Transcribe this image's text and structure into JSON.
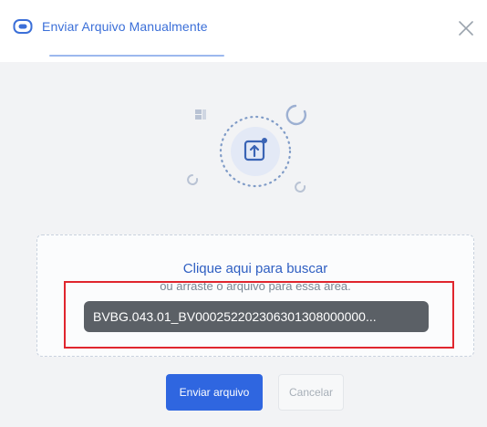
{
  "header": {
    "tab_label": "Enviar Arquivo Manualmente",
    "tab_icon": "file-badge-icon",
    "close_icon": "close-icon"
  },
  "illustration": {
    "center_icon": "upload-icon",
    "decor": [
      "grid-icon",
      "refresh-icon",
      "refresh-icon",
      "refresh-icon"
    ]
  },
  "dropzone": {
    "title": "Clique aqui para buscar",
    "subtitle": "ou arraste o arquivo para essa área.",
    "file_name": "BVBG.043.01_BV000252202306301308000000..."
  },
  "actions": {
    "submit_label": "Enviar arquivo",
    "cancel_label": "Cancelar"
  },
  "colors": {
    "accent": "#2f66e0",
    "highlight": "#e0262e"
  }
}
